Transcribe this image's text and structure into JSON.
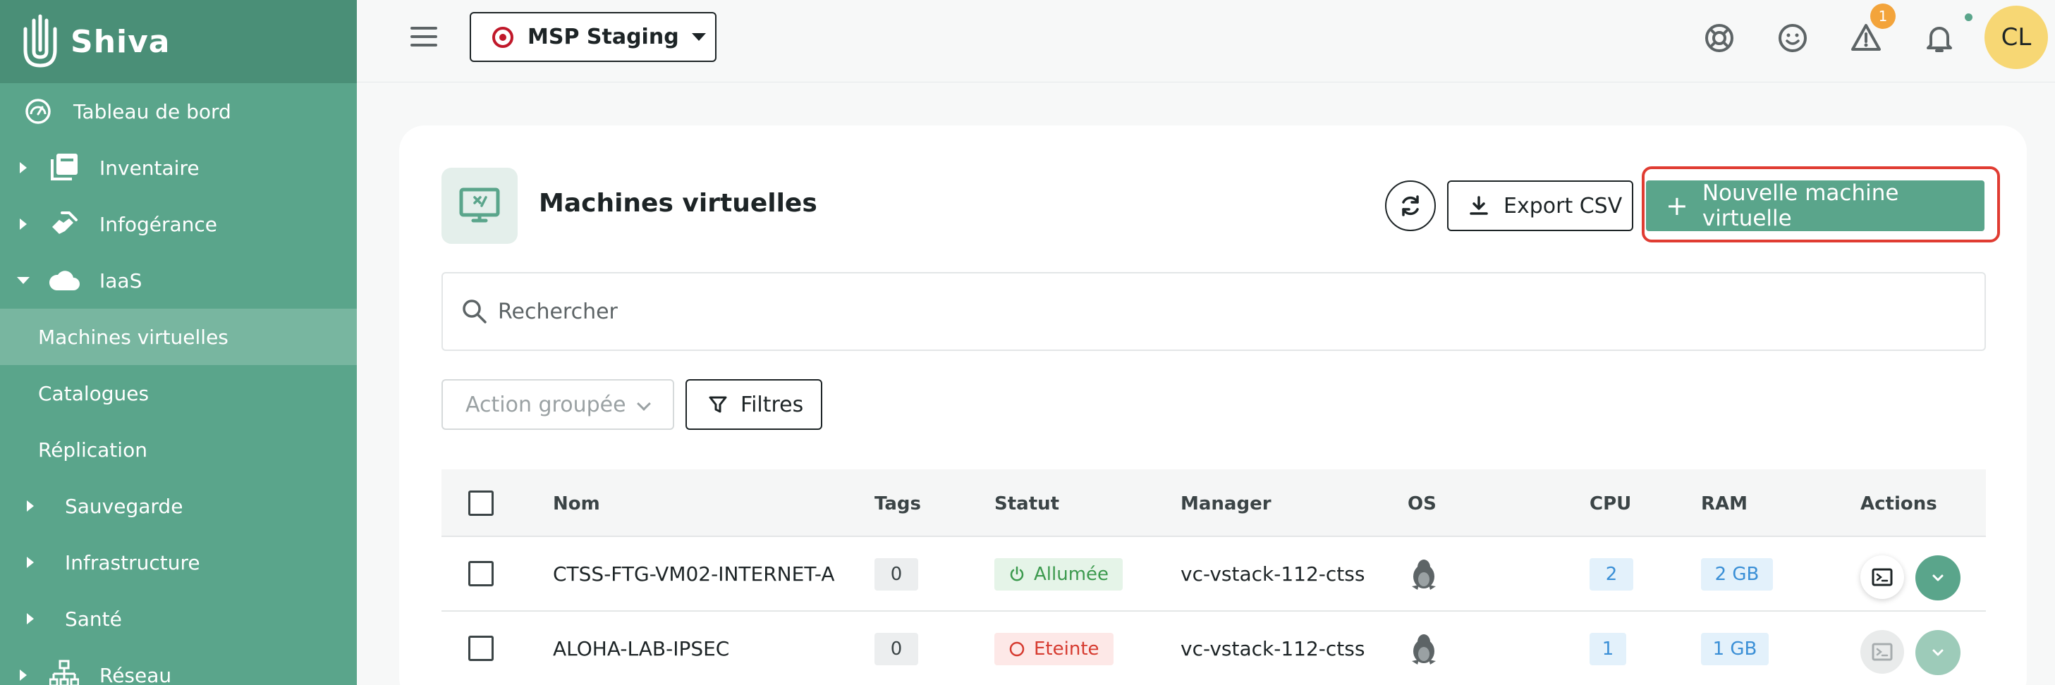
{
  "app": {
    "name": "Shiva"
  },
  "sidebar": {
    "dashboard": "Tableau de bord",
    "inventory": "Inventaire",
    "managed": "Infogérance",
    "iaas": "IaaS",
    "iaas_items": [
      "Machines virtuelles",
      "Catalogues",
      "Réplication"
    ],
    "backup": "Sauvegarde",
    "infrastructure": "Infrastructure",
    "health": "Santé",
    "network": "Réseau"
  },
  "topbar": {
    "organization": "MSP Staging",
    "alert_count": "1",
    "avatar_initials": "CL"
  },
  "page": {
    "title": "Machines virtuelles",
    "export_label": "Export CSV",
    "new_vm_label": "Nouvelle machine virtuelle",
    "search_placeholder": "Rechercher",
    "bulk_action_label": "Action groupée",
    "filters_label": "Filtres"
  },
  "table": {
    "columns": [
      "Nom",
      "Tags",
      "Statut",
      "Manager",
      "OS",
      "CPU",
      "RAM",
      "Actions"
    ],
    "rows": [
      {
        "name": "CTSS-FTG-VM02-INTERNET-A",
        "tags": "0",
        "status": "Allumée",
        "manager": "vc-vstack-112-ctss",
        "os": "linux",
        "cpu": "2",
        "ram": "2 GB"
      },
      {
        "name": "ALOHA-LAB-IPSEC",
        "tags": "0",
        "status": "Eteinte",
        "manager": "vc-vstack-112-ctss",
        "os": "linux",
        "cpu": "1",
        "ram": "1 GB"
      }
    ]
  },
  "colors": {
    "brand": "#5aa58b",
    "brand_dark": "#4a8f77",
    "highlight": "#e03c32"
  }
}
